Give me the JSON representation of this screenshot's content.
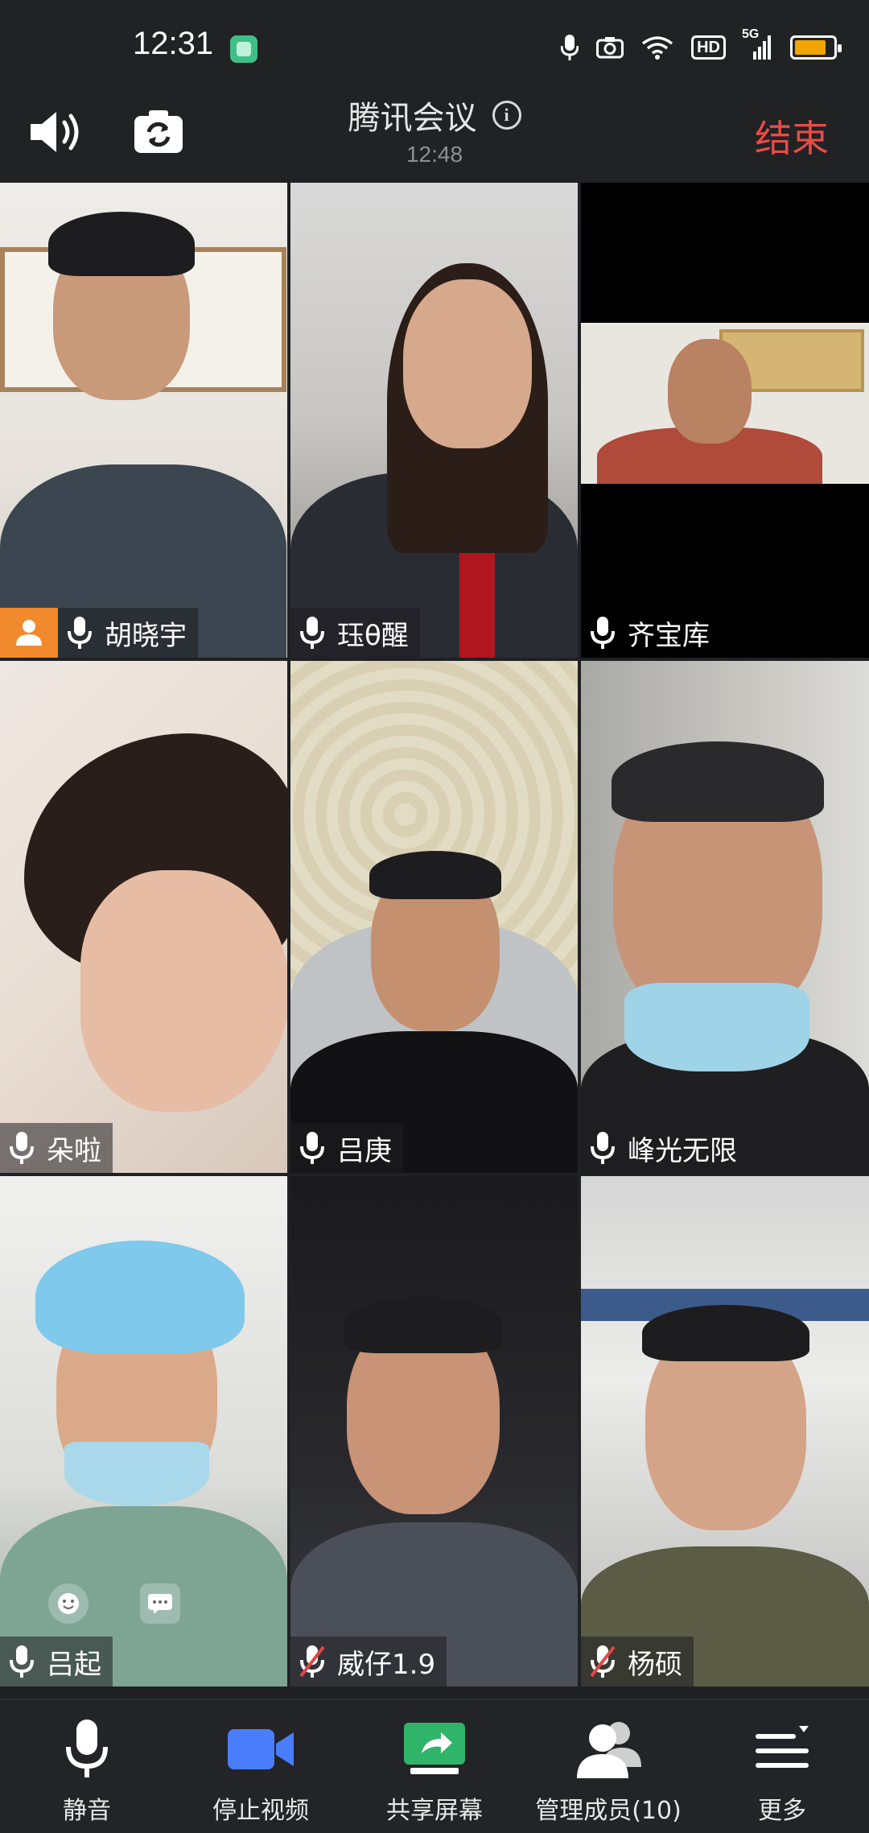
{
  "status_bar": {
    "time": "12:31",
    "hd": "HD",
    "network": "5G"
  },
  "header": {
    "title": "腾讯会议",
    "duration": "12:48",
    "end_label": "结束"
  },
  "participants": [
    {
      "name": "胡晓宇",
      "host": true,
      "muted": false
    },
    {
      "name": "珏θ醒",
      "host": false,
      "muted": false
    },
    {
      "name": "齐宝库",
      "host": false,
      "muted": false
    },
    {
      "name": "朵啦",
      "host": false,
      "muted": false
    },
    {
      "name": "吕庚",
      "host": false,
      "muted": false
    },
    {
      "name": "峰光无限",
      "host": false,
      "muted": false
    },
    {
      "name": "吕起",
      "host": false,
      "muted": false,
      "active": true
    },
    {
      "name": "威仔1.9",
      "host": false,
      "muted": true
    },
    {
      "name": "杨硕",
      "host": false,
      "muted": true
    }
  ],
  "toolbar": {
    "mute_label": "静音",
    "stop_video_label": "停止视频",
    "share_screen_label": "共享屏幕",
    "manage_members_label": "管理成员(10)",
    "more_label": "更多"
  },
  "colors": {
    "end": "#ea4a48",
    "host_tag": "#f08a2c",
    "video_icon": "#4a7dfc",
    "share_icon": "#2fb46a",
    "active_border": "#2fb46a"
  }
}
